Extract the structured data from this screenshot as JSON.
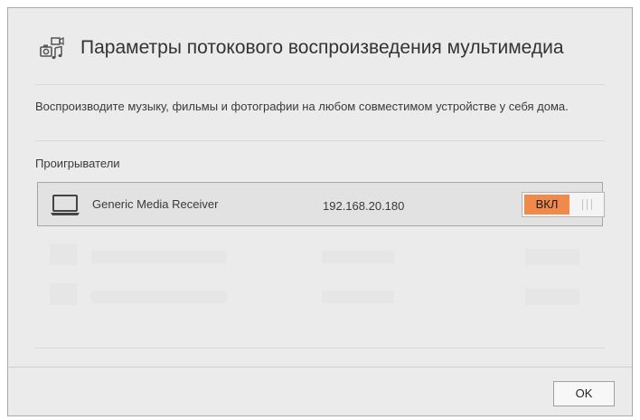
{
  "dialog": {
    "title": "Параметры потокового воспроизведения мультимедиа",
    "title_icon": "media-streaming-icon",
    "description": "Воспроизводите музыку, фильмы и фотографии на любом совместимом устройстве у себя дома.",
    "players_label": "Проигрыватели",
    "players": [
      {
        "icon": "laptop-icon",
        "name": "Generic Media Receiver",
        "ip": "192.168.20.180",
        "toggle_label": "ВКЛ",
        "enabled": true
      }
    ],
    "ok_label": "OK"
  },
  "colors": {
    "toggle_on": "#f08a4b",
    "dialog_bg": "#ebebeb",
    "row_bg": "#e2e2e2"
  }
}
